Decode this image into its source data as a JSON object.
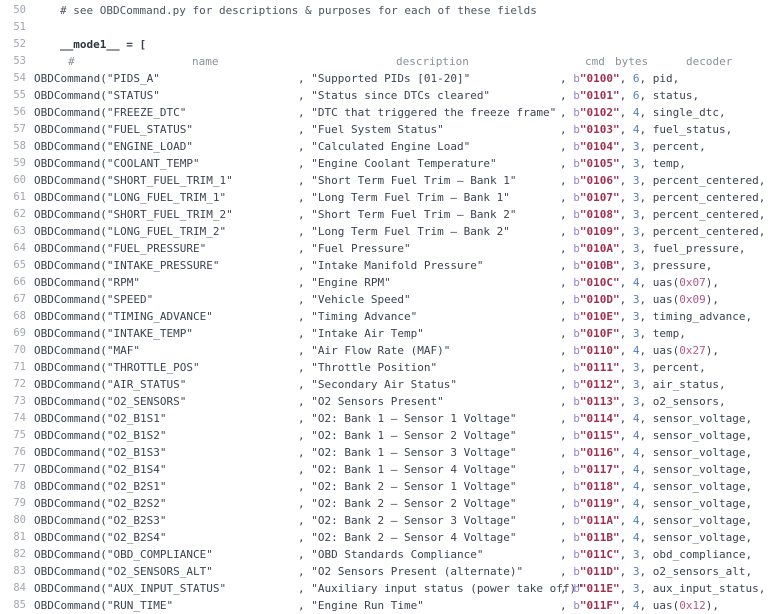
{
  "editor": {
    "background": "#ffffff",
    "gutter_color": "#a0a6b0",
    "text_color": "#3b4252",
    "bytestring_color": "#a03050",
    "number_color": "#4f7fbf",
    "hex_color": "#b05a8a",
    "prefix_color": "#9a82c4",
    "first_line_number": 50
  },
  "comment_line": {
    "number": "50",
    "text": "# see OBDCommand.py for descriptions & purposes for each of these fields"
  },
  "blank_line": {
    "number": "51"
  },
  "assignment_line": {
    "number": "52",
    "variable": "__mode1__",
    "operator": "=",
    "bracket": "["
  },
  "header_line": {
    "number": "53",
    "hash": "#",
    "name": "name",
    "description": "description",
    "cmd": "cmd",
    "bytes": "bytes",
    "decoder": "decoder"
  },
  "constructor": "OBDCommand(",
  "rows": [
    {
      "num": "54",
      "name": "\"PIDS_A\"",
      "desc": "\"Supported PIDs [01-20]\"",
      "cmd": "\"0100\"",
      "bytes": "6",
      "decoder": "pid",
      "hex": ""
    },
    {
      "num": "55",
      "name": "\"STATUS\"",
      "desc": "\"Status since DTCs cleared\"",
      "cmd": "\"0101\"",
      "bytes": "6",
      "decoder": "status",
      "hex": ""
    },
    {
      "num": "56",
      "name": "\"FREEZE_DTC\"",
      "desc": "\"DTC that triggered the freeze frame\"",
      "cmd": "\"0102\"",
      "bytes": "4",
      "decoder": "single_dtc",
      "hex": ""
    },
    {
      "num": "57",
      "name": "\"FUEL_STATUS\"",
      "desc": "\"Fuel System Status\"",
      "cmd": "\"0103\"",
      "bytes": "4",
      "decoder": "fuel_status",
      "hex": ""
    },
    {
      "num": "58",
      "name": "\"ENGINE_LOAD\"",
      "desc": "\"Calculated Engine Load\"",
      "cmd": "\"0104\"",
      "bytes": "3",
      "decoder": "percent",
      "hex": ""
    },
    {
      "num": "59",
      "name": "\"COOLANT_TEMP\"",
      "desc": "\"Engine Coolant Temperature\"",
      "cmd": "\"0105\"",
      "bytes": "3",
      "decoder": "temp",
      "hex": ""
    },
    {
      "num": "60",
      "name": "\"SHORT_FUEL_TRIM_1\"",
      "desc": "\"Short Term Fuel Trim – Bank 1\"",
      "cmd": "\"0106\"",
      "bytes": "3",
      "decoder": "percent_centered",
      "hex": ""
    },
    {
      "num": "61",
      "name": "\"LONG_FUEL_TRIM_1\"",
      "desc": "\"Long Term Fuel Trim – Bank 1\"",
      "cmd": "\"0107\"",
      "bytes": "3",
      "decoder": "percent_centered",
      "hex": ""
    },
    {
      "num": "62",
      "name": "\"SHORT_FUEL_TRIM_2\"",
      "desc": "\"Short Term Fuel Trim – Bank 2\"",
      "cmd": "\"0108\"",
      "bytes": "3",
      "decoder": "percent_centered",
      "hex": ""
    },
    {
      "num": "63",
      "name": "\"LONG_FUEL_TRIM_2\"",
      "desc": "\"Long Term Fuel Trim – Bank 2\"",
      "cmd": "\"0109\"",
      "bytes": "3",
      "decoder": "percent_centered",
      "hex": ""
    },
    {
      "num": "64",
      "name": "\"FUEL_PRESSURE\"",
      "desc": "\"Fuel Pressure\"",
      "cmd": "\"010A\"",
      "bytes": "3",
      "decoder": "fuel_pressure",
      "hex": ""
    },
    {
      "num": "65",
      "name": "\"INTAKE_PRESSURE\"",
      "desc": "\"Intake Manifold Pressure\"",
      "cmd": "\"010B\"",
      "bytes": "3",
      "decoder": "pressure",
      "hex": ""
    },
    {
      "num": "66",
      "name": "\"RPM\"",
      "desc": "\"Engine RPM\"",
      "cmd": "\"010C\"",
      "bytes": "4",
      "decoder": "uas",
      "hex": "0x07"
    },
    {
      "num": "67",
      "name": "\"SPEED\"",
      "desc": "\"Vehicle Speed\"",
      "cmd": "\"010D\"",
      "bytes": "3",
      "decoder": "uas",
      "hex": "0x09"
    },
    {
      "num": "68",
      "name": "\"TIMING_ADVANCE\"",
      "desc": "\"Timing Advance\"",
      "cmd": "\"010E\"",
      "bytes": "3",
      "decoder": "timing_advance",
      "hex": ""
    },
    {
      "num": "69",
      "name": "\"INTAKE_TEMP\"",
      "desc": "\"Intake Air Temp\"",
      "cmd": "\"010F\"",
      "bytes": "3",
      "decoder": "temp",
      "hex": ""
    },
    {
      "num": "70",
      "name": "\"MAF\"",
      "desc": "\"Air Flow Rate (MAF)\"",
      "cmd": "\"0110\"",
      "bytes": "4",
      "decoder": "uas",
      "hex": "0x27"
    },
    {
      "num": "71",
      "name": "\"THROTTLE_POS\"",
      "desc": "\"Throttle Position\"",
      "cmd": "\"0111\"",
      "bytes": "3",
      "decoder": "percent",
      "hex": ""
    },
    {
      "num": "72",
      "name": "\"AIR_STATUS\"",
      "desc": "\"Secondary Air Status\"",
      "cmd": "\"0112\"",
      "bytes": "3",
      "decoder": "air_status",
      "hex": ""
    },
    {
      "num": "73",
      "name": "\"O2_SENSORS\"",
      "desc": "\"O2 Sensors Present\"",
      "cmd": "\"0113\"",
      "bytes": "3",
      "decoder": "o2_sensors",
      "hex": ""
    },
    {
      "num": "74",
      "name": "\"O2_B1S1\"",
      "desc": "\"O2: Bank 1 – Sensor 1 Voltage\"",
      "cmd": "\"0114\"",
      "bytes": "4",
      "decoder": "sensor_voltage",
      "hex": ""
    },
    {
      "num": "75",
      "name": "\"O2_B1S2\"",
      "desc": "\"O2: Bank 1 – Sensor 2 Voltage\"",
      "cmd": "\"0115\"",
      "bytes": "4",
      "decoder": "sensor_voltage",
      "hex": ""
    },
    {
      "num": "76",
      "name": "\"O2_B1S3\"",
      "desc": "\"O2: Bank 1 – Sensor 3 Voltage\"",
      "cmd": "\"0116\"",
      "bytes": "4",
      "decoder": "sensor_voltage",
      "hex": ""
    },
    {
      "num": "77",
      "name": "\"O2_B1S4\"",
      "desc": "\"O2: Bank 1 – Sensor 4 Voltage\"",
      "cmd": "\"0117\"",
      "bytes": "4",
      "decoder": "sensor_voltage",
      "hex": ""
    },
    {
      "num": "78",
      "name": "\"O2_B2S1\"",
      "desc": "\"O2: Bank 2 – Sensor 1 Voltage\"",
      "cmd": "\"0118\"",
      "bytes": "4",
      "decoder": "sensor_voltage",
      "hex": ""
    },
    {
      "num": "79",
      "name": "\"O2_B2S2\"",
      "desc": "\"O2: Bank 2 – Sensor 2 Voltage\"",
      "cmd": "\"0119\"",
      "bytes": "4",
      "decoder": "sensor_voltage",
      "hex": ""
    },
    {
      "num": "80",
      "name": "\"O2_B2S3\"",
      "desc": "\"O2: Bank 2 – Sensor 3 Voltage\"",
      "cmd": "\"011A\"",
      "bytes": "4",
      "decoder": "sensor_voltage",
      "hex": ""
    },
    {
      "num": "81",
      "name": "\"O2_B2S4\"",
      "desc": "\"O2: Bank 2 – Sensor 4 Voltage\"",
      "cmd": "\"011B\"",
      "bytes": "4",
      "decoder": "sensor_voltage",
      "hex": ""
    },
    {
      "num": "82",
      "name": "\"OBD_COMPLIANCE\"",
      "desc": "\"OBD Standards Compliance\"",
      "cmd": "\"011C\"",
      "bytes": "3",
      "decoder": "obd_compliance",
      "hex": ""
    },
    {
      "num": "83",
      "name": "\"O2_SENSORS_ALT\"",
      "desc": "\"O2 Sensors Present (alternate)\"",
      "cmd": "\"011D\"",
      "bytes": "3",
      "decoder": "o2_sensors_alt",
      "hex": ""
    },
    {
      "num": "84",
      "name": "\"AUX_INPUT_STATUS\"",
      "desc": "\"Auxiliary input status (power take off)\"",
      "cmd": "\"011E\"",
      "bytes": "3",
      "decoder": "aux_input_status",
      "hex": ""
    },
    {
      "num": "85",
      "name": "\"RUN_TIME\"",
      "desc": "\"Engine Run Time\"",
      "cmd": "\"011F\"",
      "bytes": "4",
      "decoder": "uas",
      "hex": "0x12"
    }
  ],
  "tokens": {
    "b_prefix": "b",
    "comma": ",",
    "paren_open": "(",
    "paren_close": ")"
  }
}
